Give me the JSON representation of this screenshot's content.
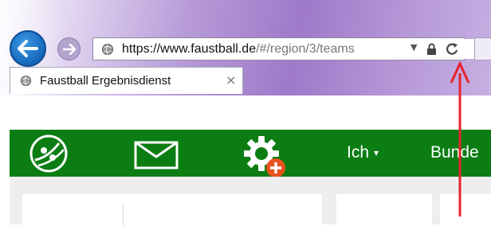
{
  "browser": {
    "address_bar": {
      "url_host": "https://www.faustball.de",
      "url_path": "/#/region/3/teams"
    },
    "tab": {
      "title": "Faustball Ergebnisdienst",
      "close_glyph": "×"
    },
    "icons": [
      "back-arrow-icon",
      "forward-arrow-icon",
      "site-globe-icon",
      "dropdown-arrow-icon",
      "lock-icon",
      "refresh-icon",
      "close-icon"
    ]
  },
  "navbar": {
    "items": [
      {
        "icon": "faustball-icon"
      },
      {
        "icon": "envelope-icon"
      },
      {
        "icon": "gear-add-icon"
      },
      {
        "label": "Ich",
        "caret": "▾"
      },
      {
        "label": "Bunde"
      }
    ],
    "color": "#0b7d13",
    "badge_color": "#e8521f"
  },
  "annotation": {
    "color": "#e8222c",
    "target": "refresh-icon"
  }
}
